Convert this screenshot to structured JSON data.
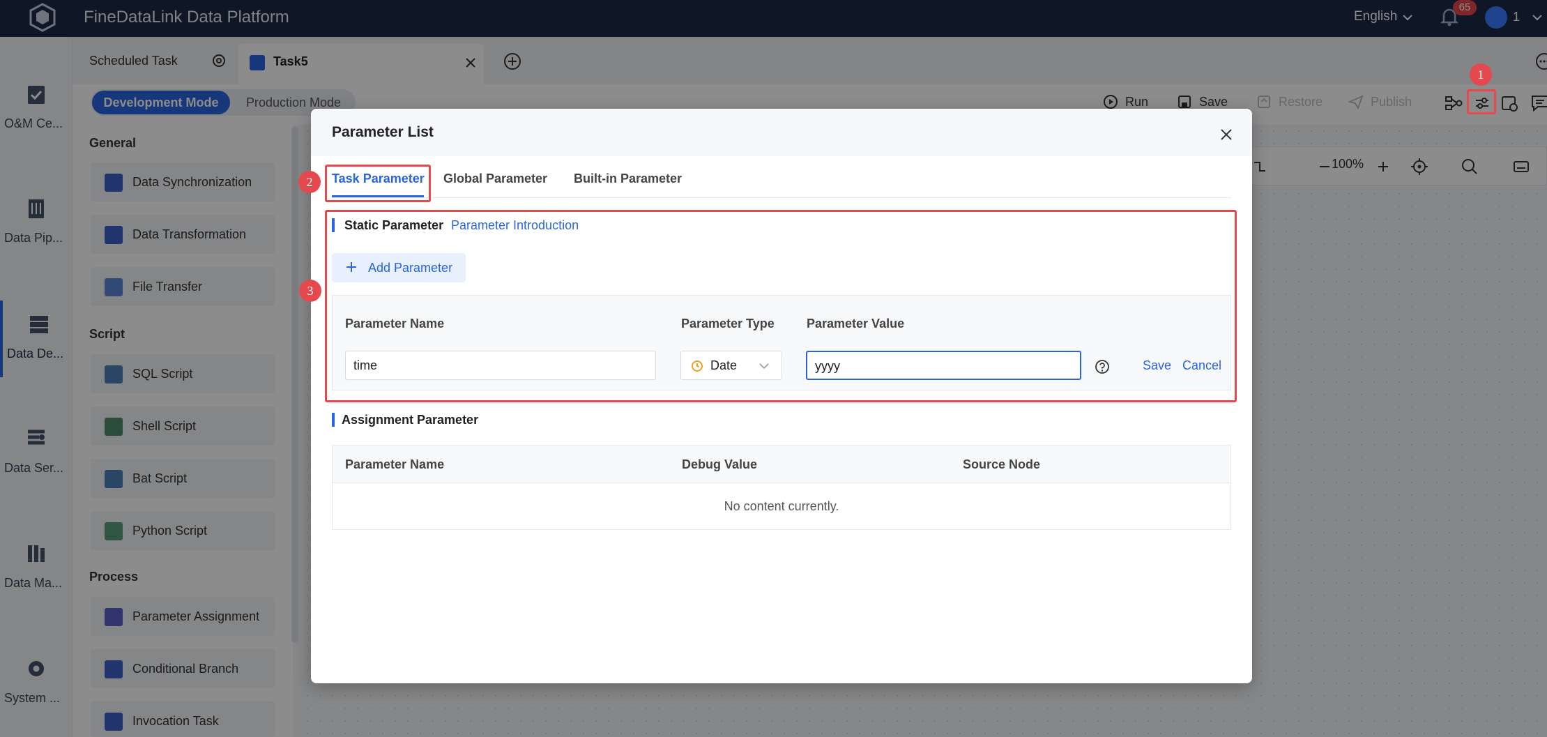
{
  "app": {
    "title": "FineDataLink Data Platform",
    "language": "English",
    "notification_count": "65",
    "user": "1"
  },
  "leftnav": {
    "items": [
      {
        "label": "O&M Ce...",
        "icon": "clipboard-check-icon"
      },
      {
        "label": "Data Pip...",
        "icon": "pipeline-icon"
      },
      {
        "label": "Data De...",
        "icon": "database-dev-icon"
      },
      {
        "label": "Data Ser...",
        "icon": "service-icon"
      },
      {
        "label": "Data Ma...",
        "icon": "data-map-icon"
      },
      {
        "label": "System ...",
        "icon": "gear-icon"
      }
    ]
  },
  "tabs": {
    "scheduled": "Scheduled Task",
    "task": "Task5"
  },
  "toolbar": {
    "dev_mode": "Development Mode",
    "prod_mode": "Production Mode",
    "run": "Run",
    "save": "Save",
    "restore": "Restore",
    "publish": "Publish"
  },
  "panel": {
    "sections": {
      "general": "General",
      "script": "Script",
      "process": "Process"
    },
    "general": [
      "Data Synchronization",
      "Data Transformation",
      "File Transfer"
    ],
    "script": [
      "SQL Script",
      "Shell Script",
      "Bat Script",
      "Python Script"
    ],
    "process": [
      "Parameter Assignment",
      "Conditional Branch",
      "Invocation Task"
    ]
  },
  "canvas": {
    "zoom": "100%"
  },
  "markers": [
    "1",
    "2",
    "3"
  ],
  "modal": {
    "title": "Parameter List",
    "tabs": [
      "Task Parameter",
      "Global Parameter",
      "Built-in Parameter"
    ],
    "static": {
      "heading": "Static Parameter",
      "link": "Parameter Introduction",
      "add_button": "Add Parameter",
      "columns": [
        "Parameter Name",
        "Parameter Type",
        "Parameter Value"
      ],
      "row": {
        "name": "time",
        "type": "Date",
        "value": "yyyy",
        "save": "Save",
        "cancel": "Cancel"
      }
    },
    "assignment": {
      "heading": "Assignment Parameter",
      "columns": [
        "Parameter Name",
        "Debug Value",
        "Source Node"
      ],
      "empty": "No content currently."
    }
  },
  "colors": {
    "accent": "#2a64e0",
    "topbar": "#1d2b48",
    "highlight": "#e5484d"
  }
}
